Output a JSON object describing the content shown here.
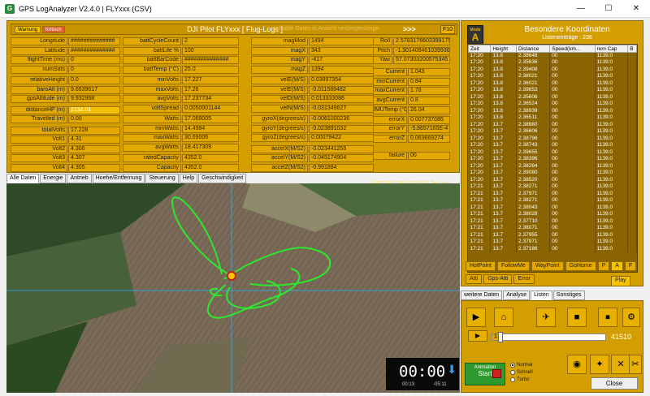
{
  "window": {
    "title": "GPS LogAnalyzer V2.4.0  |  FLYxxx (CSV)",
    "minimize": "—",
    "maximize": "☐",
    "close": "✕"
  },
  "header": {
    "badge1": "Warnung",
    "badge2": "Kritisch",
    "title": "DJI Pilot FLYxxx [ Flug-Logs ]",
    "warning": "sensible Daten in Ansicht verbergen/zeige",
    "arrows": ">>>",
    "f10": "F10"
  },
  "col1": [
    {
      "l": "Longitude",
      "v": "##############"
    },
    {
      "l": "Latitude",
      "v": "##############"
    },
    {
      "l": "flightTime (ms)",
      "v": "0"
    },
    {
      "l": "numSats",
      "v": "0"
    },
    {
      "l": "relativeHeight",
      "v": "0.0"
    },
    {
      "l": "baroAlt (m)",
      "v": "9.6639617"
    },
    {
      "l": "gpsAltitude (m)",
      "v": "9.932968"
    },
    {
      "l": "distanceHP (m)",
      "v": "2132.01"
    },
    {
      "l": "Travelled (m)",
      "v": "0.00"
    },
    {
      "l": "totalVolts",
      "v": "17.228"
    },
    {
      "l": "Volt1",
      "v": "4.31"
    },
    {
      "l": "Volt2",
      "v": "4.306"
    },
    {
      "l": "Volt3",
      "v": "4.307"
    },
    {
      "l": "Volt4",
      "v": "4.305"
    }
  ],
  "col2": [
    {
      "l": "battCycleCount",
      "v": "2"
    },
    {
      "l": "battLife %",
      "v": "100"
    },
    {
      "l": "battBarCode",
      "v": "##############"
    },
    {
      "l": "battTemp (°C)",
      "v": "25.0"
    },
    {
      "l": "minVolts",
      "v": "17.227"
    },
    {
      "l": "maxVolts",
      "v": "17.26"
    },
    {
      "l": "avgVolts",
      "v": "17.237734"
    },
    {
      "l": "voltSpread",
      "v": "0.0050001144"
    },
    {
      "l": "Watts",
      "v": "17.069005"
    },
    {
      "l": "minWatts",
      "v": "14.4984"
    },
    {
      "l": "maxWatts",
      "v": "30.69006"
    },
    {
      "l": "avgWatts",
      "v": "18.417309"
    },
    {
      "l": "ratedCapacity",
      "v": "4352.0"
    },
    {
      "l": "Capacity",
      "v": "4352.0"
    }
  ],
  "col3": [
    {
      "l": "magMod",
      "v": "1494"
    },
    {
      "l": "magX",
      "v": "343"
    },
    {
      "l": "magY",
      "v": "-417"
    },
    {
      "l": "magZ",
      "v": "1394"
    },
    {
      "l": "velE(M/S)",
      "v": "0.03897354"
    },
    {
      "l": "velE(M/S)",
      "v": "-0.011589482"
    },
    {
      "l": "velD(M/S)",
      "v": "0.013333086"
    },
    {
      "l": "velN(M/S)",
      "v": "-0.031349627"
    },
    {
      "l": "gyroX(degrees/s)",
      "v": "-0.0061000236"
    },
    {
      "l": "gyroY(degrees/s)",
      "v": "-0.023891032"
    },
    {
      "l": "gyroZ(degrees/s)",
      "v": "0.00079422"
    },
    {
      "l": "accelX(M/S2)",
      "v": "-0.023441256"
    },
    {
      "l": "accelY(M/S2)",
      "v": "-0.045174904"
    },
    {
      "l": "accelZ(M/S2)",
      "v": "-0.991884"
    }
  ],
  "col4a": [
    {
      "l": "Roll",
      "v": "2.5783176603399175"
    },
    {
      "l": "Pitch",
      "v": "-1.3014094610399305"
    },
    {
      "l": "Yaw",
      "v": "57.07303200575345"
    }
  ],
  "col4b": [
    {
      "l": "Current",
      "v": "1.043"
    },
    {
      "l": "minCurrent",
      "v": "0.84"
    },
    {
      "l": "maxCurrent",
      "v": "1.78"
    },
    {
      "l": "avgCurrent",
      "v": "0.8"
    }
  ],
  "col4c": [
    {
      "l": "IMUTemp (°C)",
      "v": "26.04"
    },
    {
      "l": "errorX",
      "v": "0.007737085"
    },
    {
      "l": "errorY",
      "v": "-5.8657165E-4"
    },
    {
      "l": "errorZ",
      "v": "0.063669274"
    },
    {
      "l": "failure",
      "v": "00"
    }
  ],
  "freeware": "FREEWARE ©2016  D.Teichert",
  "tabs": [
    "Alle Daten",
    "Energie",
    "Antrieb",
    "Hoehe/Entfernung",
    "Steuerung",
    "Help",
    "Geschwindigkeit"
  ],
  "timer": {
    "display": "00:00",
    "start": "00:13",
    "end": "-05:11"
  },
  "right": {
    "mode_top": "Mode",
    "mode": "A",
    "title": "Besondere Koordinaten",
    "count_label": "Listeneinträge :",
    "count": "238",
    "columns": [
      "Zeit",
      "Height",
      "Distance",
      "Speed(km...",
      "rem Cap",
      "B"
    ],
    "rows": [
      [
        "17:20",
        "13.8",
        "2.38648",
        "00",
        "1139.0"
      ],
      [
        "17:20",
        "13.8",
        "2.35636",
        "00",
        "1139.0"
      ],
      [
        "17:20",
        "13.8",
        "2.39408",
        "00",
        "1139.0"
      ],
      [
        "17:20",
        "13.8",
        "2.38021",
        "00",
        "1139.0"
      ],
      [
        "17:20",
        "13.8",
        "2.36021",
        "00",
        "1139.0"
      ],
      [
        "17:20",
        "13.8",
        "2.39653",
        "00",
        "1139.0"
      ],
      [
        "17:20",
        "13.8",
        "2.35606",
        "00",
        "1139.0"
      ],
      [
        "17:20",
        "13.8",
        "2.36524",
        "00",
        "1139.0"
      ],
      [
        "17:20",
        "13.8",
        "2.38939",
        "00",
        "1139.0"
      ],
      [
        "17:20",
        "13.8",
        "2.36511",
        "00",
        "1139.0"
      ],
      [
        "17:20",
        "13.7",
        "2.38880",
        "00",
        "1139.0"
      ],
      [
        "17:20",
        "13.7",
        "2.36606",
        "00",
        "1139.0"
      ],
      [
        "17:20",
        "13.7",
        "2.38796",
        "00",
        "1139.0"
      ],
      [
        "17:20",
        "13.7",
        "2.38743",
        "00",
        "1139.0"
      ],
      [
        "17:20",
        "13.7",
        "2.39655",
        "00",
        "1139.0"
      ],
      [
        "17:20",
        "13.7",
        "2.38396",
        "00",
        "1139.0"
      ],
      [
        "17:20",
        "13.7",
        "2.38264",
        "00",
        "1139.0"
      ],
      [
        "17:20",
        "13.7",
        "2.39080",
        "00",
        "1139.0"
      ],
      [
        "17:20",
        "13.7",
        "2.38520",
        "00",
        "1139.0"
      ],
      [
        "17:21",
        "13.7",
        "2.38271",
        "00",
        "1139.0"
      ],
      [
        "17:21",
        "13.7",
        "2.37971",
        "00",
        "1139.0"
      ],
      [
        "17:21",
        "13.7",
        "2.38271",
        "00",
        "1139.0"
      ],
      [
        "17:21",
        "13.7",
        "2.38043",
        "00",
        "1139.0"
      ],
      [
        "17:21",
        "13.7",
        "2.38028",
        "00",
        "1139.0"
      ],
      [
        "17:21",
        "13.7",
        "2.37710",
        "00",
        "1139.0"
      ],
      [
        "17:21",
        "13.7",
        "2.38071",
        "00",
        "1139.0"
      ],
      [
        "17:21",
        "13.7",
        "2.37955",
        "00",
        "1139.0"
      ],
      [
        "17:21",
        "13.7",
        "2.37971",
        "00",
        "1139.0"
      ],
      [
        "17:21",
        "13.7",
        "2.37186",
        "00",
        "1139.0"
      ]
    ],
    "btns1": [
      "HotPoint",
      "FollowMe",
      "WayPoint",
      "GoHome",
      "P",
      "A",
      "F"
    ],
    "btns2": [
      "Atti",
      "Gps-Atti",
      "Error"
    ],
    "play": "Play"
  },
  "tabs2": [
    "weitere Daten",
    "Analyse",
    "Listen",
    "Sonstiges"
  ],
  "lower": {
    "icons": [
      "Start-icon",
      "Home-icon",
      "Straight-icon",
      "Stop-icon",
      "Ende-icon"
    ],
    "slider_value": "1",
    "slider_fraction": 0.06,
    "counter": "41510",
    "anim_title": "Animation",
    "anim_start": "Start",
    "radios": [
      "Normal",
      "Schnell",
      "Turbo"
    ],
    "close": "Close"
  }
}
